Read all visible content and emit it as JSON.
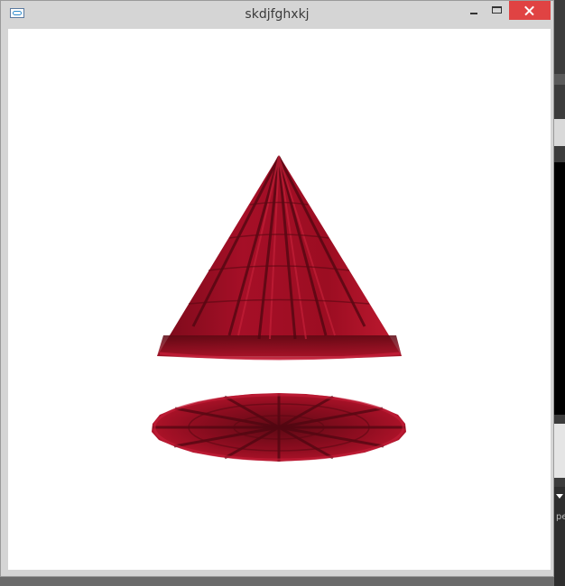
{
  "window": {
    "title": "skdjfghxkj",
    "icon": "app-window-icon",
    "controls": [
      "minimize-icon",
      "maximize-icon",
      "close-icon"
    ]
  },
  "scene": {
    "objects": [
      "cone",
      "disc"
    ],
    "texture_color": "#a30f25",
    "background_color": "#ffffff"
  },
  "background_app": {
    "partial_text": "pe"
  }
}
